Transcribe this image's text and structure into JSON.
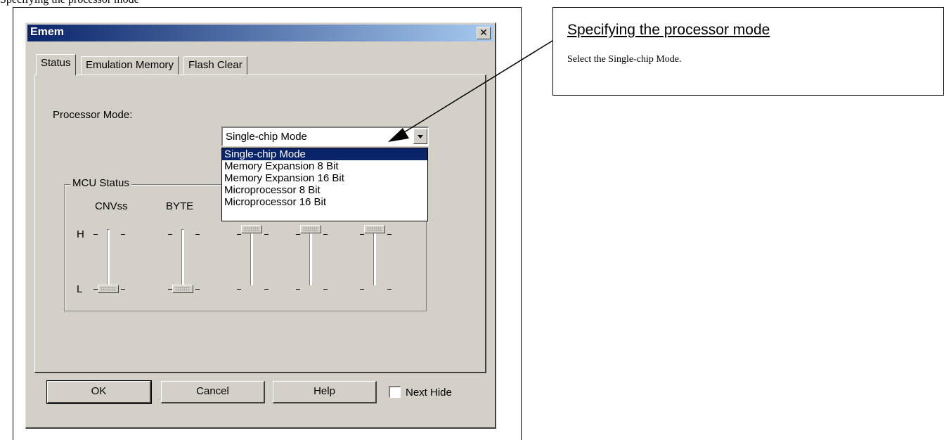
{
  "page_caption": "Specifying the processor mode",
  "window": {
    "title": "Emem",
    "close_icon": "close-icon"
  },
  "tabs": [
    {
      "label": "Status",
      "active": true
    },
    {
      "label": "Emulation Memory",
      "active": false
    },
    {
      "label": "Flash Clear",
      "active": false
    }
  ],
  "processor_mode": {
    "label": "Processor Mode:",
    "selected": "Single-chip Mode",
    "options": [
      "Single-chip Mode",
      "Memory Expansion 8 Bit",
      "Memory Expansion 16 Bit",
      "Microprocessor 8 Bit",
      "Microprocessor 16 Bit"
    ],
    "highlighted_index": 0
  },
  "mcu_status": {
    "title": "MCU Status",
    "high_label": "H",
    "low_label": "L",
    "columns": [
      {
        "label": "CNVss",
        "level": "L"
      },
      {
        "label": "BYTE",
        "level": "L"
      },
      {
        "label": "",
        "level": "H"
      },
      {
        "label": "",
        "level": "H"
      },
      {
        "label": "",
        "level": "H"
      }
    ]
  },
  "buttons": {
    "ok": "OK",
    "cancel": "Cancel",
    "help": "Help",
    "next_hide": "Next Hide",
    "next_hide_checked": false
  },
  "callout": {
    "title": "Specifying the processor mode",
    "text": "Select the Single-chip Mode."
  }
}
